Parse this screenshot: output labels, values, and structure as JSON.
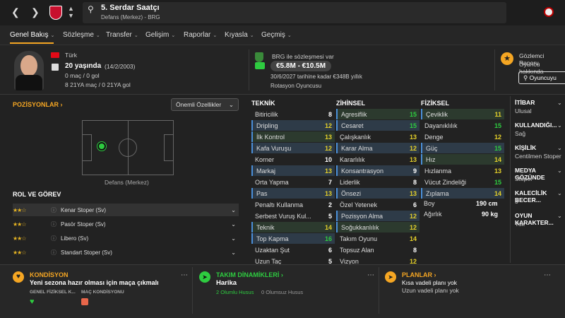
{
  "player": {
    "name": "5. Serdar Saatçı",
    "subtitle": "Defans (Merkez) - BRG",
    "nationality": "Türk",
    "age": "20 yaşında",
    "dob": "(14/2/2003)",
    "stats1": "0 maç / 0 gol",
    "stats2": "8 21YA maç / 0 21YA gol"
  },
  "tabs": [
    "Genel Bakış",
    "Sözleşme",
    "Transfer",
    "Gelişim",
    "Raporlar",
    "Kıyasla",
    "Geçmiş"
  ],
  "contract": {
    "club": "BRG ile sözleşmesi var",
    "value": "€5.8M - €10.5M",
    "until": "30/6/2027 tarihine kadar €348B yıllık",
    "status": "Rotasyon Oyuncusu"
  },
  "scout": {
    "title": "Gözlemci Raporu",
    "desc": "Oyuncu hakkında",
    "button": "Oyuncuyu"
  },
  "positions": {
    "title": "POZİSYONLAR",
    "dropdown": "Önemli Özellikler",
    "label": "Defans (Merkez)"
  },
  "roles": {
    "title": "ROL VE GÖREV",
    "items": [
      {
        "stars": "★★☆",
        "label": "Kenar Stoper (Sv)"
      },
      {
        "stars": "★★☆",
        "label": "Pasör Stoper (Sv)"
      },
      {
        "stars": "★★☆",
        "label": "Libero (Sv)"
      },
      {
        "stars": "★★☆",
        "label": "Standart Stoper (Sv)"
      }
    ]
  },
  "technical": {
    "title": "TEKNİK",
    "rows": [
      [
        "Bitiricilik",
        "8"
      ],
      [
        "Dripling",
        "12"
      ],
      [
        "İlk Kontrol",
        "13"
      ],
      [
        "Kafa Vuruşu",
        "12"
      ],
      [
        "Korner",
        "10"
      ],
      [
        "Markaj",
        "13"
      ],
      [
        "Orta Yapma",
        "7"
      ],
      [
        "Pas",
        "13"
      ],
      [
        "Penaltı Kullanma",
        "2"
      ],
      [
        "Serbest Vuruş Kul...",
        "5"
      ],
      [
        "Teknik",
        "14"
      ],
      [
        "Top Kapma",
        "16"
      ],
      [
        "Uzaktan Şut",
        "6"
      ],
      [
        "Uzun Taç",
        "5"
      ]
    ]
  },
  "mental": {
    "title": "ZİHİNSEL",
    "rows": [
      [
        "Agresiflik",
        "15"
      ],
      [
        "Cesaret",
        "15"
      ],
      [
        "Çalışkanlık",
        "13"
      ],
      [
        "Karar Alma",
        "12"
      ],
      [
        "Kararlılık",
        "13"
      ],
      [
        "Konsantrasyon",
        "9"
      ],
      [
        "Liderlik",
        "8"
      ],
      [
        "Önsezi",
        "13"
      ],
      [
        "Özel Yetenek",
        "6"
      ],
      [
        "Pozisyon Alma",
        "12"
      ],
      [
        "Soğukkanlılık",
        "12"
      ],
      [
        "Takım Oyunu",
        "14"
      ],
      [
        "Topsuz Alan",
        "8"
      ],
      [
        "Vizyon",
        "12"
      ]
    ]
  },
  "physical": {
    "title": "FİZİKSEL",
    "rows": [
      [
        "Çeviklik",
        "11"
      ],
      [
        "Dayanıklılık",
        "15"
      ],
      [
        "Denge",
        "12"
      ],
      [
        "Güç",
        "15"
      ],
      [
        "Hız",
        "14"
      ],
      [
        "Hızlanma",
        "13"
      ],
      [
        "Vücut Zindeliği",
        "15"
      ],
      [
        "Zıplama",
        "14"
      ]
    ],
    "height_label": "Boy",
    "height": "190 cm",
    "weight_label": "Ağırlık",
    "weight": "90 kg"
  },
  "side": [
    {
      "label": "İTİBAR",
      "value": "Ulusal"
    },
    {
      "label": "KULLANDIĞI...",
      "value": "Sağ"
    },
    {
      "label": "KİŞİLİK",
      "value": "Centilmen Stoper"
    },
    {
      "label": "MEDYA GÖZÜNDE",
      "value": "Stoper"
    },
    {
      "label": "KALECİLİK BECER...",
      "value": "3"
    },
    {
      "label": "OYUN KARAKTER...",
      "value": "Yok"
    }
  ],
  "bottom": {
    "cond_title": "KONDİSYON",
    "cond_text": "Yeni sezona hazır olması için maça çıkmalı",
    "cond_l1": "GENEL FİZİKSEL K...",
    "cond_l2": "MAÇ KONDİSYONU",
    "team_title": "TAKIM DİNAMİKLERİ",
    "team_val": "Harika",
    "team_pos": "2 Olumlu Husus",
    "team_neg": "0 Olumsuz Husus",
    "plan_title": "PLANLAR",
    "plan_text": "Kısa vadeli planı yok",
    "plan_text2": "Uzun vadeli planı yok"
  },
  "colors": {
    "accent": "#f5a623",
    "highlight": "#2e3b48",
    "green": "#2ecc40",
    "yellow": "#e6d22a"
  }
}
